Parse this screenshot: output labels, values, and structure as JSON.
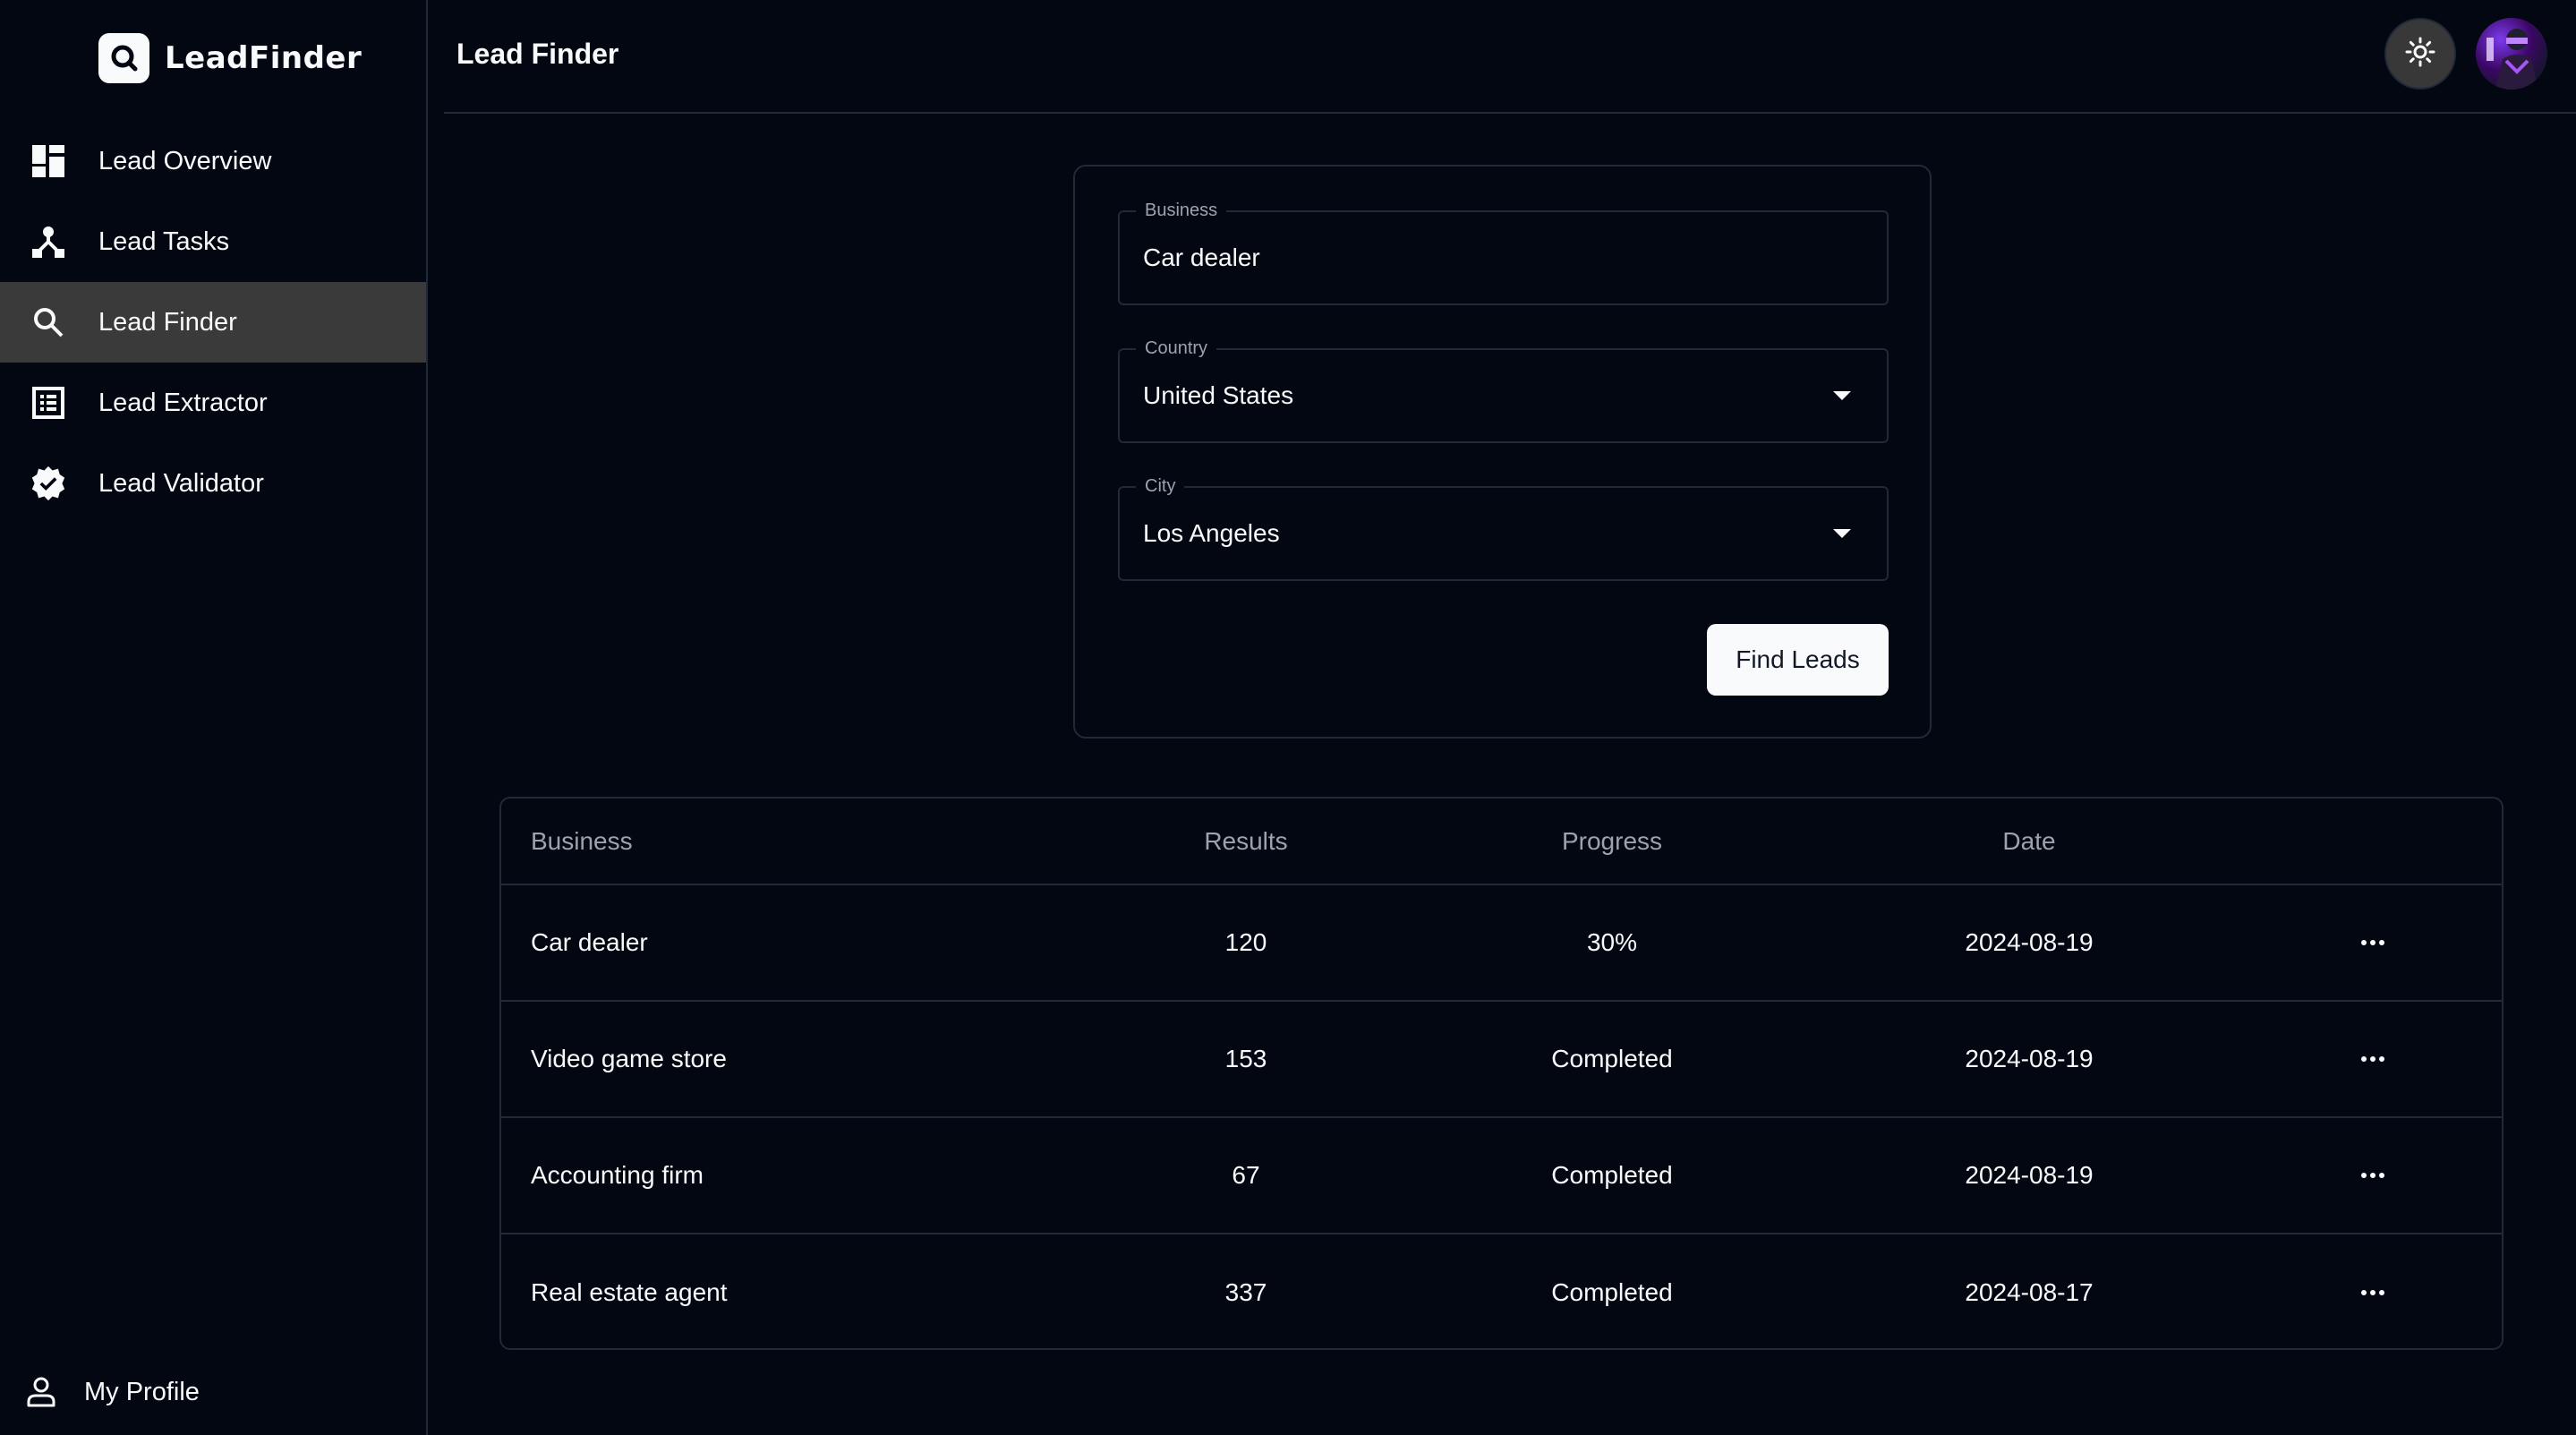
{
  "app": {
    "brand": "LeadFinder"
  },
  "sidebar": {
    "items": [
      {
        "label": "Lead Overview",
        "icon": "dashboard-icon",
        "active": false
      },
      {
        "label": "Lead Tasks",
        "icon": "hierarchy-icon",
        "active": false
      },
      {
        "label": "Lead Finder",
        "icon": "search-icon",
        "active": true
      },
      {
        "label": "Lead Extractor",
        "icon": "list-icon",
        "active": false
      },
      {
        "label": "Lead Validator",
        "icon": "verified-badge-icon",
        "active": false
      }
    ],
    "profile_label": "My Profile"
  },
  "header": {
    "title": "Lead Finder",
    "theme_toggle_icon": "sun-icon",
    "avatar": "user-avatar"
  },
  "form": {
    "business": {
      "label": "Business",
      "value": "Car dealer"
    },
    "country": {
      "label": "Country",
      "value": "United States"
    },
    "city": {
      "label": "City",
      "value": "Los Angeles"
    },
    "submit_label": "Find Leads"
  },
  "table": {
    "columns": [
      "Business",
      "Results",
      "Progress",
      "Date"
    ],
    "rows": [
      {
        "business": "Car dealer",
        "results": "120",
        "progress": "30%",
        "date": "2024-08-19"
      },
      {
        "business": "Video game store",
        "results": "153",
        "progress": "Completed",
        "date": "2024-08-19"
      },
      {
        "business": "Accounting firm",
        "results": "67",
        "progress": "Completed",
        "date": "2024-08-19"
      },
      {
        "business": "Real estate agent",
        "results": "337",
        "progress": "Completed",
        "date": "2024-08-17"
      }
    ]
  },
  "colors": {
    "background": "#030712",
    "border": "#1f2937",
    "active_nav": "#3a3a3a",
    "text": "#f9fafb",
    "muted_text": "#9ca3af"
  }
}
